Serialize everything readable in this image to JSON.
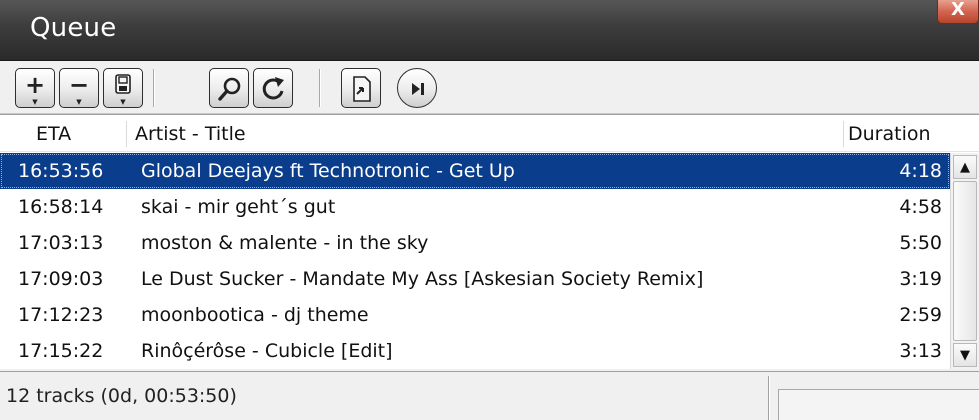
{
  "window": {
    "title": "Queue",
    "close_label": "X"
  },
  "toolbar": {
    "buttons": [
      {
        "icon": "plus-icon",
        "glyph": "+"
      },
      {
        "icon": "minus-icon",
        "glyph": "−"
      },
      {
        "icon": "save-icon"
      },
      {
        "icon": "search-icon"
      },
      {
        "icon": "refresh-icon"
      },
      {
        "icon": "export-icon"
      },
      {
        "icon": "play-next-icon"
      }
    ]
  },
  "list": {
    "columns": {
      "eta": "ETA",
      "title": "Artist - Title",
      "duration": "Duration"
    },
    "rows": [
      {
        "eta": "16:53:56",
        "title": "Global Deejays ft Technotronic - Get Up",
        "duration": "4:18",
        "selected": true
      },
      {
        "eta": "16:58:14",
        "title": "skai - mir geht´s gut",
        "duration": "4:58"
      },
      {
        "eta": "17:03:13",
        "title": "moston & malente - in the sky",
        "duration": "5:50"
      },
      {
        "eta": "17:09:03",
        "title": "Le Dust Sucker - Mandate My Ass [Askesian Society Remix]",
        "duration": "3:19"
      },
      {
        "eta": "17:12:23",
        "title": "moonbootica - dj theme",
        "duration": "2:59"
      },
      {
        "eta": "17:15:22",
        "title": "Rinôçérôse - Cubicle [Edit]",
        "duration": "3:13"
      }
    ]
  },
  "scrollbar": {
    "up": "▲",
    "down": "▼"
  },
  "status": {
    "summary": "12 tracks (0d, 00:53:50)"
  },
  "colors": {
    "selection": "#0a3d8c",
    "titlebar": "#3c3c3c"
  }
}
